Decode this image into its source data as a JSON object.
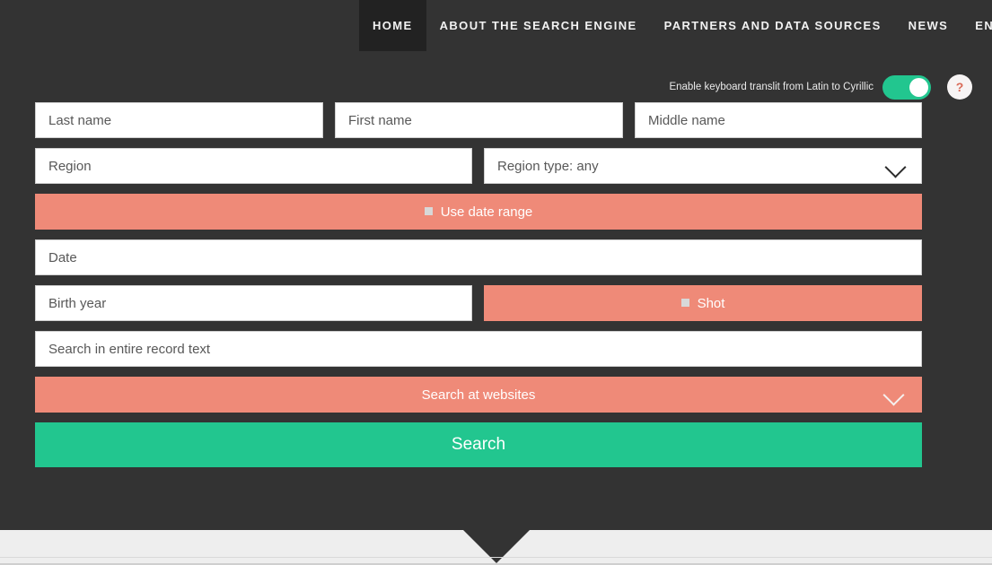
{
  "nav": {
    "items": [
      {
        "label": "HOME",
        "active": true
      },
      {
        "label": "ABOUT THE SEARCH ENGINE",
        "active": false
      },
      {
        "label": "PARTNERS AND DATA SOURCES",
        "active": false
      },
      {
        "label": "NEWS",
        "active": false
      }
    ],
    "language": "EN"
  },
  "translit": {
    "label": "Enable keyboard translit from Latin to Cyrillic",
    "enabled": true,
    "help_label": "?"
  },
  "form": {
    "last_name": "Last name",
    "first_name": "First name",
    "middle_name": "Middle name",
    "region": "Region",
    "region_type": "Region type: any",
    "use_date_range": "Use date range",
    "date": "Date",
    "birth_year": "Birth year",
    "shot": "Shot",
    "record_text": "Search in entire record text",
    "search_at_websites": "Search at websites",
    "search_button": "Search"
  },
  "colors": {
    "background": "#333333",
    "active_tab": "#222222",
    "salmon": "#ef8a78",
    "green": "#22c68f",
    "bottom_section": "#eeeeee",
    "field_background": "#ffffff",
    "help_glyph": "#d96a57"
  }
}
